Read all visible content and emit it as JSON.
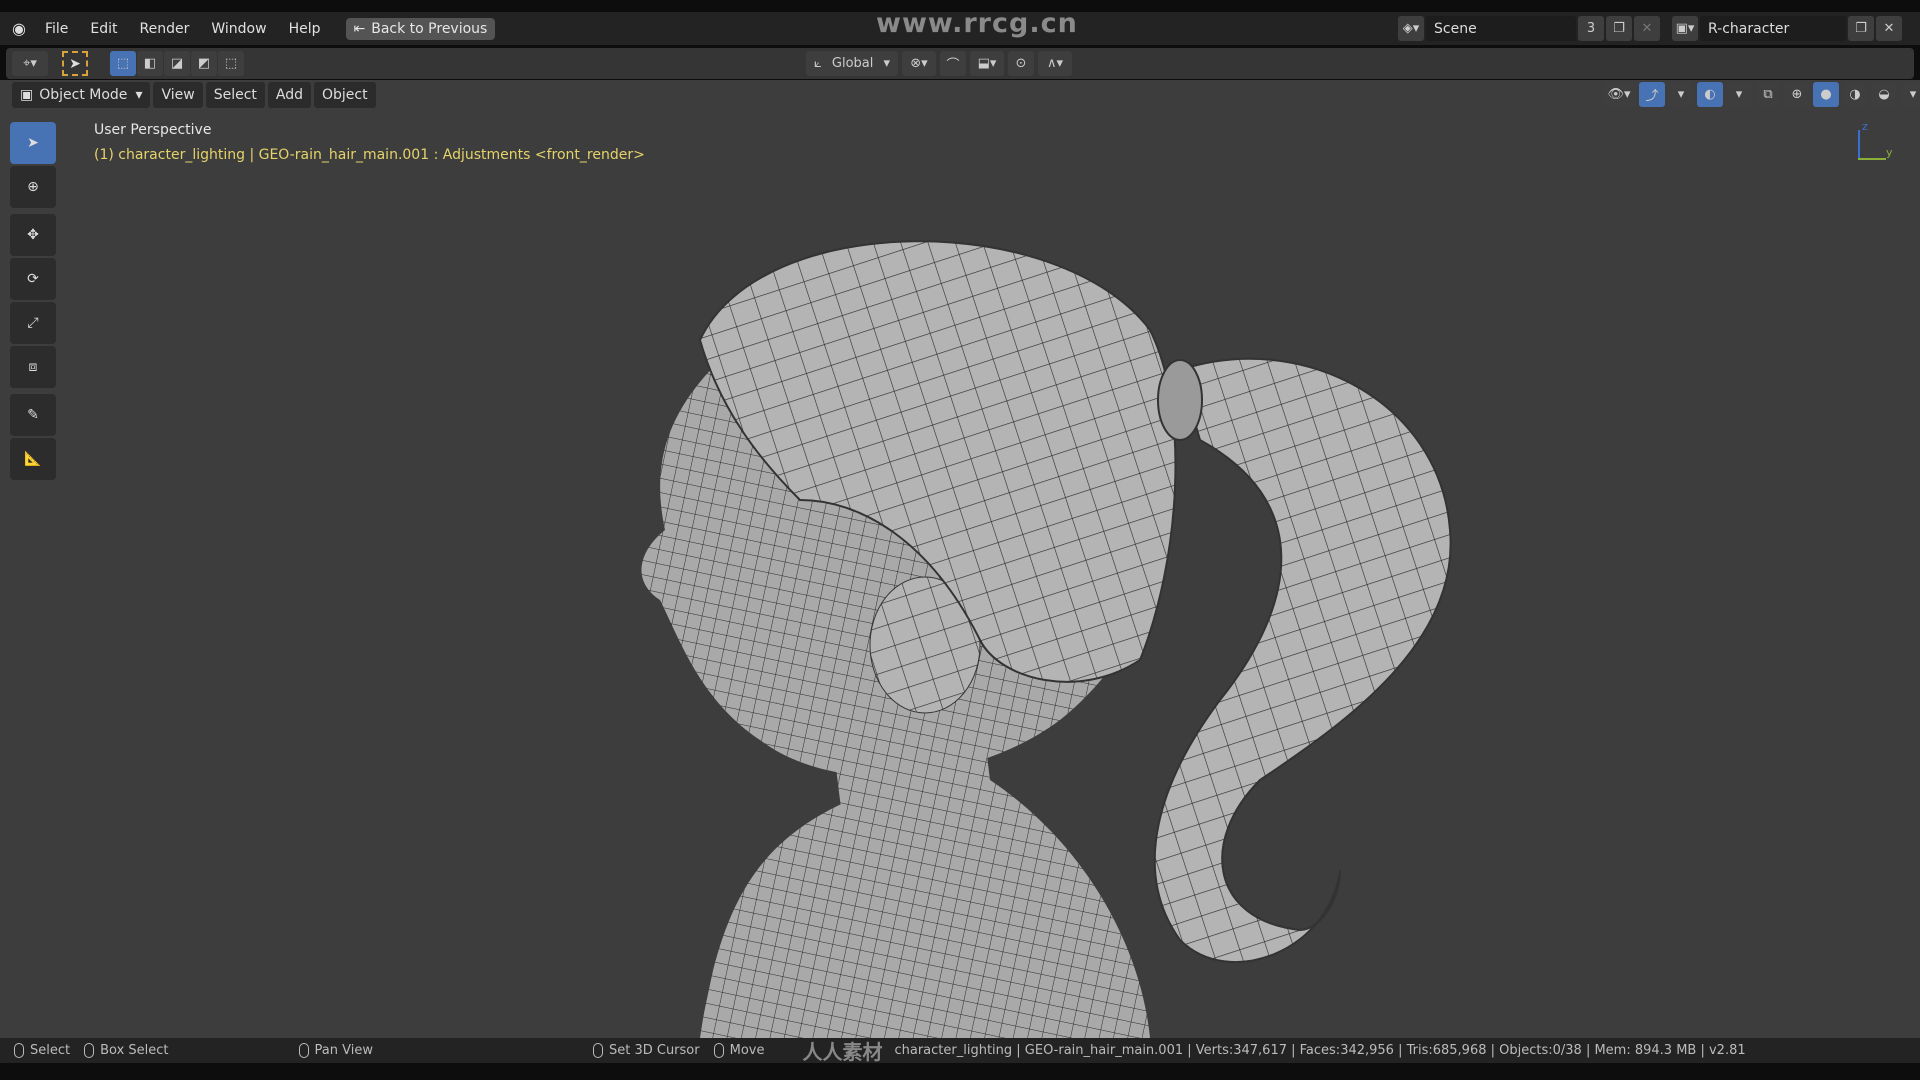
{
  "watermark": "www.rrcg.cn",
  "menu": {
    "items": [
      "File",
      "Edit",
      "Render",
      "Window",
      "Help"
    ],
    "back_button": "Back to Previous"
  },
  "scene": {
    "label": "Scene",
    "users": "3",
    "view_layer": "R-character"
  },
  "tool_header": {
    "orientation": "Global"
  },
  "viewport_header": {
    "mode": "Object Mode",
    "menus": [
      "View",
      "Select",
      "Add",
      "Object"
    ]
  },
  "overlay": {
    "view_name": "User Perspective",
    "object_info": "(1) character_lighting | GEO-rain_hair_main.001 : Adjustments <front_render>",
    "axis_z": "z",
    "axis_y": "y"
  },
  "toolbar": {
    "tools": [
      "select-box-icon",
      "cursor-icon",
      "move-icon",
      "rotate-icon",
      "scale-icon",
      "transform-icon",
      "annotate-icon",
      "measure-icon"
    ]
  },
  "statusbar": {
    "select": "Select",
    "box_select": "Box Select",
    "pan_view": "Pan View",
    "set_cursor": "Set 3D Cursor",
    "move": "Move",
    "stats": "character_lighting | GEO-rain_hair_main.001 | Verts:347,617 | Faces:342,956 | Tris:685,968 | Objects:0/38 | Mem: 894.3 MB | v2.81",
    "logo_text": "人人素材"
  },
  "colors": {
    "accent": "#4772b3",
    "info_text": "#e5d36a",
    "viewport": "#3d3d3d"
  }
}
